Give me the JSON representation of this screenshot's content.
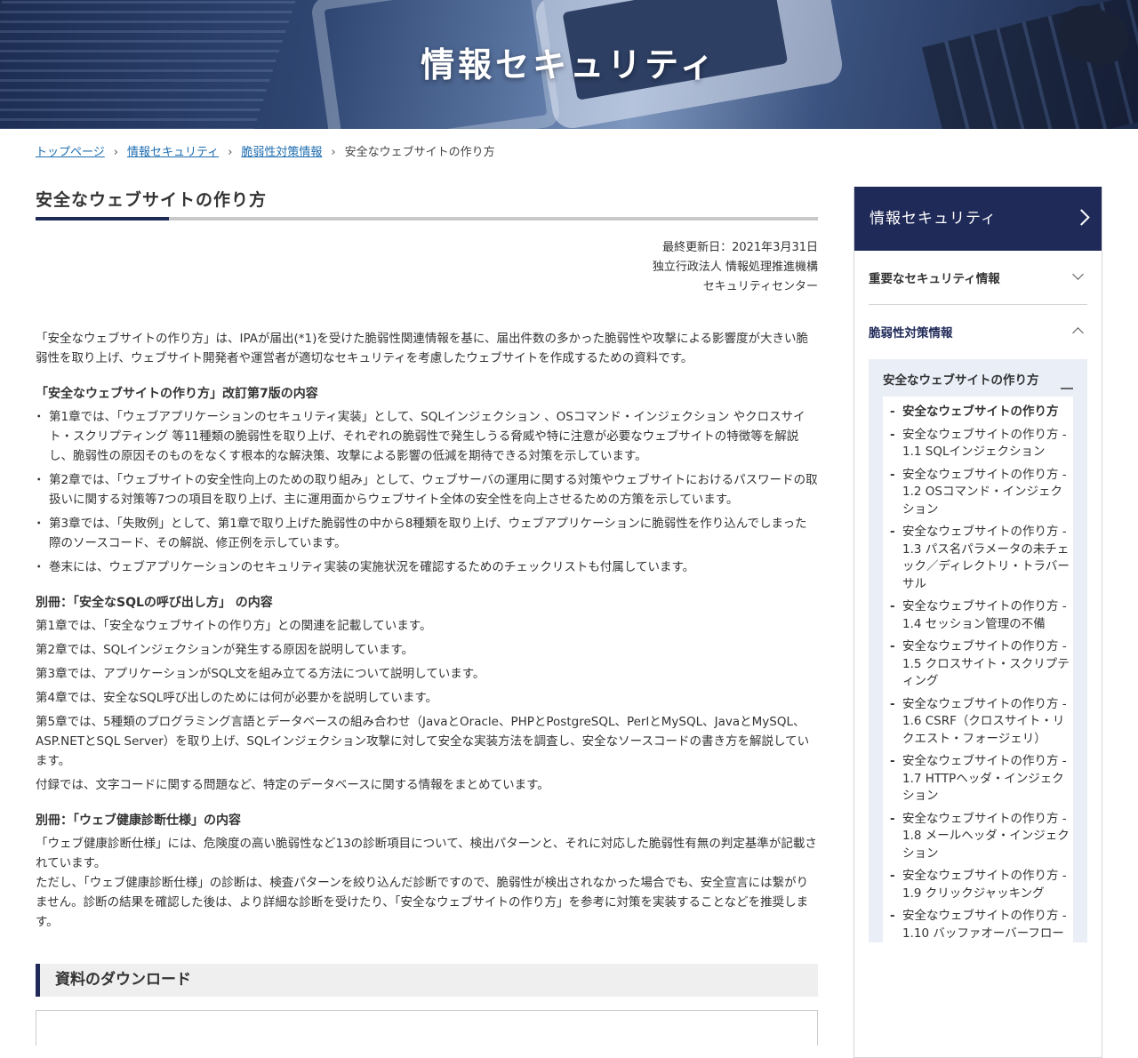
{
  "header": {
    "title": "情報セキュリティ"
  },
  "breadcrumb": {
    "items": [
      "トップページ",
      "情報セキュリティ",
      "脆弱性対策情報"
    ],
    "separator": "›",
    "current": "安全なウェブサイトの作り方"
  },
  "article": {
    "title": "安全なウェブサイトの作り方",
    "meta": {
      "updated": "最終更新日：2021年3月31日",
      "org": "独立行政法人 情報処理推進機構",
      "center": "セキュリティセンター"
    },
    "intro": "「安全なウェブサイトの作り方」は、IPAが届出(*1)を受けた脆弱性関連情報を基に、届出件数の多かった脆弱性や攻撃による影響度が大きい脆弱性を取り上げ、ウェブサイト開発者や運営者が適切なセキュリティを考慮したウェブサイトを作成するための資料です。",
    "section1": {
      "heading": "「安全なウェブサイトの作り方」改訂第7版の内容",
      "items": [
        "第1章では、「ウェブアプリケーションのセキュリティ実装」として、SQLインジェクション 、OSコマンド・インジェクション やクロスサイト・スクリプティング 等11種類の脆弱性を取り上げ、それぞれの脆弱性で発生しうる脅威や特に注意が必要なウェブサイトの特徴等を解説し、脆弱性の原因そのものをなくす根本的な解決策、攻撃による影響の低減を期待できる対策を示しています。",
        "第2章では、「ウェブサイトの安全性向上のための取り組み」として、ウェブサーバの運用に関する対策やウェブサイトにおけるパスワードの取扱いに関する対策等7つの項目を取り上げ、主に運用面からウェブサイト全体の安全性を向上させるための方策を示しています。",
        "第3章では、「失敗例」として、第1章で取り上げた脆弱性の中から8種類を取り上げ、ウェブアプリケーションに脆弱性を作り込んでしまった際のソースコード、その解説、修正例を示しています。",
        "巻末には、ウェブアプリケーションのセキュリティ実装の実施状況を確認するためのチェックリストも付属しています。"
      ]
    },
    "section2": {
      "heading": "別冊：「安全なSQLの呼び出し方」 の内容",
      "lines": [
        "第1章では、「安全なウェブサイトの作り方」との関連を記載しています。",
        "第2章では、SQLインジェクションが発生する原因を説明しています。",
        "第3章では、アプリケーションがSQL文を組み立てる方法について説明しています。",
        "第4章では、安全なSQL呼び出しのためには何が必要かを説明しています。",
        "第5章では、5種類のプログラミング言語とデータベースの組み合わせ（JavaとOracle、PHPとPostgreSQL、PerlとMySQL、JavaとMySQL、ASP.NETとSQL Server）を取り上げ、SQLインジェクション攻撃に対して安全な実装方法を調査し、安全なソースコードの書き方を解説しています。",
        "付録では、文字コードに関する問題など、特定のデータベースに関する情報をまとめています。"
      ]
    },
    "section3": {
      "heading": "別冊：「ウェブ健康診断仕様」の内容",
      "p1": "「ウェブ健康診断仕様」には、危険度の高い脆弱性など13の診断項目について、検出パターンと、それに対応した脆弱性有無の判定基準が記載されています。",
      "p2": "ただし、「ウェブ健康診断仕様」の診断は、検査パターンを絞り込んだ診断ですので、脆弱性が検出されなかった場合でも、安全宣言には繋がりません。診断の結果を確認した後は、より詳細な診断を受けたり、「安全なウェブサイトの作り方」を参考に対策を実装することなどを推奨します。"
    },
    "download": {
      "heading": "資料のダウンロード"
    }
  },
  "sidebar": {
    "header": "情報セキュリティ",
    "sections": [
      {
        "label": "重要なセキュリティ情報",
        "state": "collapsed"
      },
      {
        "label": "脆弱性対策情報",
        "state": "expanded"
      }
    ],
    "subsection": {
      "label": "安全なウェブサイトの作り方",
      "links": [
        "安全なウェブサイトの作り方",
        "安全なウェブサイトの作り方 - 1.1 SQLインジェクション",
        "安全なウェブサイトの作り方 - 1.2 OSコマンド・インジェクション",
        "安全なウェブサイトの作り方 - 1.3 パス名パラメータの未チェック／ディレクトリ・トラバーサル",
        "安全なウェブサイトの作り方 - 1.4 セッション管理の不備",
        "安全なウェブサイトの作り方 - 1.5 クロスサイト・スクリプティング",
        "安全なウェブサイトの作り方 - 1.6 CSRF（クロスサイト・リクエスト・フォージェリ）",
        "安全なウェブサイトの作り方 - 1.7 HTTPヘッダ・インジェクション",
        "安全なウェブサイトの作り方 - 1.8 メールヘッダ・インジェクション",
        "安全なウェブサイトの作り方 - 1.9 クリックジャッキング",
        "安全なウェブサイトの作り方 - 1.10 バッファオーバーフロー"
      ]
    }
  },
  "colors": {
    "navy": "#1f2a58",
    "link": "#1e6db0",
    "panel": "#e9eef7"
  }
}
